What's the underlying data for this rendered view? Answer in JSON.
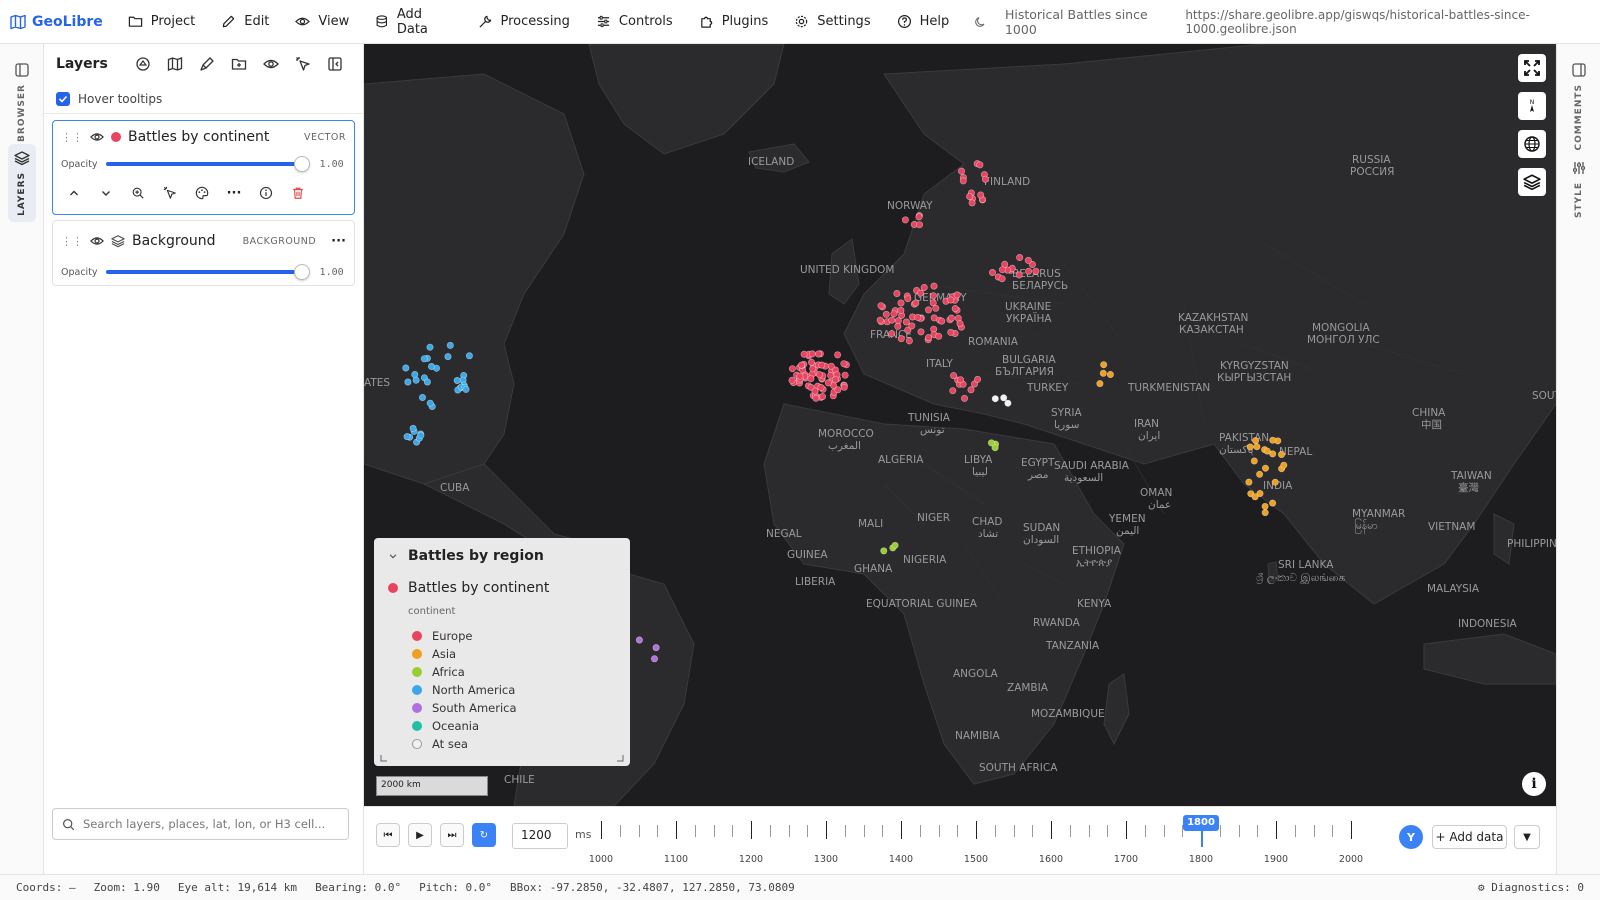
{
  "app": {
    "name": "GeoLibre"
  },
  "menu": [
    {
      "label": "Project",
      "icon": "folder-icon"
    },
    {
      "label": "Edit",
      "icon": "pencil-icon"
    },
    {
      "label": "View",
      "icon": "eye-icon"
    },
    {
      "label": "Add Data",
      "icon": "database-icon"
    },
    {
      "label": "Processing",
      "icon": "wrench-icon"
    },
    {
      "label": "Controls",
      "icon": "sliders-icon"
    },
    {
      "label": "Plugins",
      "icon": "puzzle-icon"
    },
    {
      "label": "Settings",
      "icon": "gear-icon"
    },
    {
      "label": "Help",
      "icon": "help-circle-icon"
    }
  ],
  "project_title": "Historical Battles since 1000",
  "share_url": "https://share.geolibre.app/giswqs/historical-battles-since-1000.geolibre.json",
  "left_rail": {
    "browser": "BROWSER",
    "layers": "LAYERS"
  },
  "right_rail": {
    "comments": "COMMENTS",
    "style": "STYLE"
  },
  "layers_panel": {
    "title": "Layers",
    "hover_tooltips": "Hover tooltips",
    "layers": [
      {
        "name": "Battles by continent",
        "type": "VECTOR",
        "opacity_label": "Opacity",
        "opacity": "1.00",
        "color": "#e8445f"
      },
      {
        "name": "Background",
        "type": "BACKGROUND",
        "opacity_label": "Opacity",
        "opacity": "1.00"
      }
    ],
    "search_placeholder": "Search layers, places, lat, lon, or H3 cell..."
  },
  "legend": {
    "title": "Battles by region",
    "layer": "Battles by continent",
    "field": "continent",
    "items": [
      {
        "label": "Europe",
        "color": "#e8445f"
      },
      {
        "label": "Asia",
        "color": "#f0a020"
      },
      {
        "label": "Africa",
        "color": "#9acd32"
      },
      {
        "label": "North America",
        "color": "#3aa8e8"
      },
      {
        "label": "South America",
        "color": "#b070e0"
      },
      {
        "label": "Oceania",
        "color": "#20c0a8"
      },
      {
        "label": "At sea",
        "color": "#f2f2f2"
      }
    ]
  },
  "map": {
    "scale": "2000 km",
    "places": [
      "ICELAND",
      "NORWAY",
      "UNITED KINGDOM",
      "RUSSIA",
      "РОССИЯ",
      "KAZAKHSTAN",
      "КАЗАКСТАН",
      "MONGOLIA",
      "МОНГОЛ УЛС",
      "UKRAINE",
      "УКРАЇНА",
      "ROMANIA",
      "TURKEY",
      "TURKMENISTAN",
      "KYRGYZSTAN",
      "КЫРГЫЗСТАН",
      "CHINA",
      "中国",
      "SYRIA",
      "سوريا",
      "IRAN",
      "ایران",
      "PAKISTAN",
      "پاکستان",
      "NEPAL",
      "TAIWAN",
      "臺灣",
      "INDIA",
      "SAUDI ARABIA",
      "السعودية",
      "OMAN",
      "عمان",
      "YEMEN",
      "اليمن",
      "MYANMAR",
      "မြန်မာ",
      "VIETNAM",
      "PHILIPPINE",
      "TUNISIA",
      "تونس",
      "MOROCCO",
      "المغرب",
      "ALGERIA",
      "LIBYA",
      "ليبيا",
      "EGYPT",
      "مصر",
      "MALI",
      "NIGER",
      "CHAD",
      "تشاد",
      "SUDAN",
      "السودان",
      "ETHIOPIA",
      "ኢትዮጵያ",
      "NIGERIA",
      "GUINEA",
      "LIBERIA",
      "GHANA",
      "EQUATORIAL GUINEA",
      "KENYA",
      "RWANDA",
      "TANZANIA",
      "ANGOLA",
      "ZAMBIA",
      "MOZAMBIQUE",
      "NAMIBIA",
      "SOUTH AFRICA",
      "SRI LANKA",
      "ශ්‍රී ලංකාව இலங்கை",
      "MALAYSIA",
      "INDONESIA",
      "CUBA",
      "CHILE",
      "BELARUS",
      "БЕЛАРУСЬ",
      "BULGARIA",
      "БЪЛГАРИЯ",
      "GERMANY",
      "FRANCE",
      "ITALY",
      "FINLAND",
      "SOUTH",
      "ATES",
      "NEGAL"
    ]
  },
  "timeline": {
    "interval_ms": "1200",
    "ms_label": "ms",
    "ticks": [
      "1000",
      "1100",
      "1200",
      "1300",
      "1400",
      "1500",
      "1600",
      "1700",
      "1800",
      "1900",
      "2000"
    ],
    "current": "1800",
    "current_value": 1800,
    "range": [
      1000,
      2000
    ],
    "avatar": "Y",
    "add_data": "+ Add data"
  },
  "status": {
    "coords": "Coords: —",
    "zoom": "Zoom: 1.90",
    "eye_alt": "Eye alt: 19,614 km",
    "bearing": "Bearing: 0.0°",
    "pitch": "Pitch: 0.0°",
    "bbox": "BBox: -97.2850, -32.4807, 127.2850, 73.0809",
    "diagnostics": "⚙ Diagnostics: 0"
  }
}
